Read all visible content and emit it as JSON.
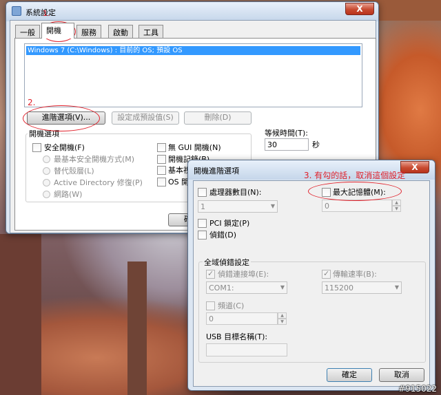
{
  "main_window": {
    "title": "系統設定",
    "close_glyph": "X",
    "tabs": [
      "一般",
      "開機",
      "服務",
      "啟動",
      "工具"
    ],
    "os_list": [
      "Windows 7 (C:\\Windows) : 目前的 OS; 預設 OS"
    ],
    "buttons": {
      "advanced": "進階選項(V)...",
      "set_default": "設定成預設值(S)",
      "delete": "刪除(D)"
    },
    "boot_options": {
      "label": "開機選項",
      "safe_boot": "安全開機(F)",
      "radios": [
        "最基本安全開機方式(M)",
        "替代殼層(L)",
        "Active Directory 修復(P)",
        "網路(W)"
      ],
      "no_gui": "無 GUI 開機(N)",
      "boot_log": "開機記錄(B)",
      "base_video": "基本視",
      "os_boot_info": "OS 開機"
    },
    "timeout": {
      "label": "等候時間(T):",
      "value": "30",
      "unit": "秒"
    },
    "ok_partial": "確"
  },
  "adv_dialog": {
    "title": "開機進階選項",
    "close_glyph": "X",
    "num_proc": {
      "label": "處理器數目(N):",
      "value": "1"
    },
    "max_mem": {
      "label": "最大記憶體(M):",
      "value": "0"
    },
    "pci_lock": "PCI 鎖定(P)",
    "debug": "偵錯(D)",
    "global_debug": {
      "label": "全域偵錯設定",
      "debug_port": {
        "label": "偵錯連接埠(E):",
        "value": "COM1:"
      },
      "baud": {
        "label": "傳輸速率(B):",
        "value": "115200"
      },
      "channel": {
        "label": "頻道(C)",
        "value": "0"
      },
      "usb_target": {
        "label": "USB 目標名稱(T):",
        "value": ""
      }
    },
    "ok": "確定",
    "cancel": "取消"
  },
  "annotations": {
    "step1": "1.",
    "step2": "2.",
    "step3": "3. 有勾的話，取消這個設定"
  },
  "watermark": "#915022",
  "colors": {
    "annotation": "#e0202a",
    "selection": "#3399ff"
  }
}
